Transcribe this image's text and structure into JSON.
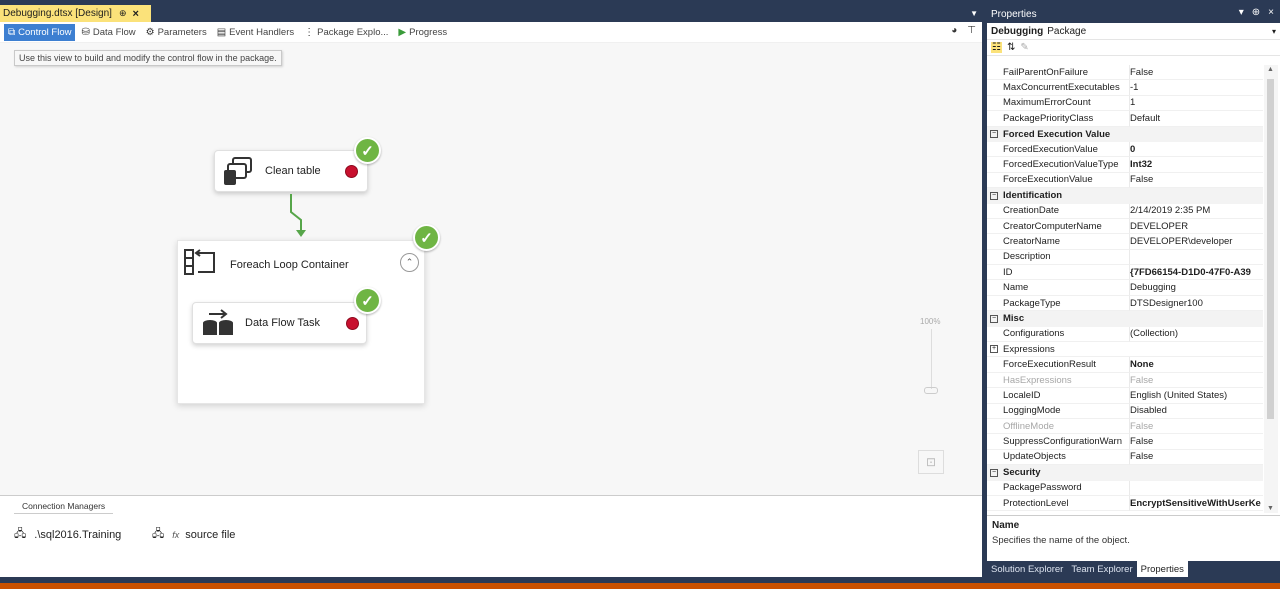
{
  "document_tab": {
    "title": "Debugging.dtsx [Design]",
    "pin": "⊕",
    "close": "×"
  },
  "toolbar": {
    "items": [
      {
        "label": "Control Flow",
        "icon": "control-flow-icon"
      },
      {
        "label": "Data Flow",
        "icon": "data-flow-icon"
      },
      {
        "label": "Parameters",
        "icon": "parameters-icon"
      },
      {
        "label": "Event Handlers",
        "icon": "event-handlers-icon"
      },
      {
        "label": "Package Explo...",
        "icon": "package-explorer-icon"
      },
      {
        "label": "Progress",
        "icon": "progress-play-icon"
      }
    ]
  },
  "tooltip": "Use this view to build and modify the control flow in the package.",
  "canvas": {
    "clean_table": {
      "label": "Clean table"
    },
    "foreach": {
      "label": "Foreach Loop Container"
    },
    "data_flow_task": {
      "label": "Data Flow Task"
    },
    "zoom_label": "100%"
  },
  "connection_managers": {
    "tab_label": "Connection Managers",
    "items": [
      {
        "label": ".\\sql2016.Training",
        "icon": "database-connection-icon"
      },
      {
        "label": "source file",
        "icon": "file-connection-icon",
        "fx": "fx"
      }
    ]
  },
  "properties": {
    "title": "Properties",
    "object_name": "Debugging",
    "object_type": "Package",
    "rows": [
      {
        "kind": "prop",
        "name": "FailParentOnFailure",
        "value": "False"
      },
      {
        "kind": "prop",
        "name": "MaxConcurrentExecutables",
        "value": "-1"
      },
      {
        "kind": "prop",
        "name": "MaximumErrorCount",
        "value": "1"
      },
      {
        "kind": "prop",
        "name": "PackagePriorityClass",
        "value": "Default"
      },
      {
        "kind": "cat",
        "name": "Forced Execution Value",
        "box": "−"
      },
      {
        "kind": "prop",
        "name": "ForcedExecutionValue",
        "value": "0",
        "bold": true
      },
      {
        "kind": "prop",
        "name": "ForcedExecutionValueType",
        "value": "Int32",
        "bold": true
      },
      {
        "kind": "prop",
        "name": "ForceExecutionValue",
        "value": "False"
      },
      {
        "kind": "cat",
        "name": "Identification",
        "box": "−"
      },
      {
        "kind": "prop",
        "name": "CreationDate",
        "value": "2/14/2019 2:35 PM"
      },
      {
        "kind": "prop",
        "name": "CreatorComputerName",
        "value": "DEVELOPER"
      },
      {
        "kind": "prop",
        "name": "CreatorName",
        "value": "DEVELOPER\\developer"
      },
      {
        "kind": "prop",
        "name": "Description",
        "value": ""
      },
      {
        "kind": "prop",
        "name": "ID",
        "value": "{7FD66154-D1D0-47F0-A39",
        "bold": true
      },
      {
        "kind": "prop",
        "name": "Name",
        "value": "Debugging"
      },
      {
        "kind": "prop",
        "name": "PackageType",
        "value": "DTSDesigner100"
      },
      {
        "kind": "cat",
        "name": "Misc",
        "box": "−"
      },
      {
        "kind": "prop",
        "name": "Configurations",
        "value": "(Collection)"
      },
      {
        "kind": "exp",
        "name": "Expressions",
        "box": "+"
      },
      {
        "kind": "prop",
        "name": "ForceExecutionResult",
        "value": "None",
        "bold": true
      },
      {
        "kind": "prop",
        "name": "HasExpressions",
        "value": "False",
        "disabled": true
      },
      {
        "kind": "prop",
        "name": "LocaleID",
        "value": "English (United States)"
      },
      {
        "kind": "prop",
        "name": "LoggingMode",
        "value": "Disabled"
      },
      {
        "kind": "prop",
        "name": "OfflineMode",
        "value": "False",
        "disabled": true
      },
      {
        "kind": "prop",
        "name": "SuppressConfigurationWarn",
        "value": "False"
      },
      {
        "kind": "prop",
        "name": "UpdateObjects",
        "value": "False"
      },
      {
        "kind": "cat",
        "name": "Security",
        "box": "−"
      },
      {
        "kind": "prop",
        "name": "PackagePassword",
        "value": ""
      },
      {
        "kind": "prop",
        "name": "ProtectionLevel",
        "value": "EncryptSensitiveWithUserKe",
        "bold": true
      }
    ],
    "description": {
      "name": "Name",
      "text": "Specifies the name of the object."
    },
    "tabs": [
      {
        "label": "Solution Explorer"
      },
      {
        "label": "Team Explorer"
      },
      {
        "label": "Properties",
        "active": true
      }
    ]
  },
  "colors": {
    "chrome": "#2b3a55",
    "active_tab": "#fbe27a",
    "active_toolbar": "#3d7fd1",
    "success": "#6fb544",
    "breakpoint": "#c8102e",
    "status_bar": "#ca5100"
  }
}
